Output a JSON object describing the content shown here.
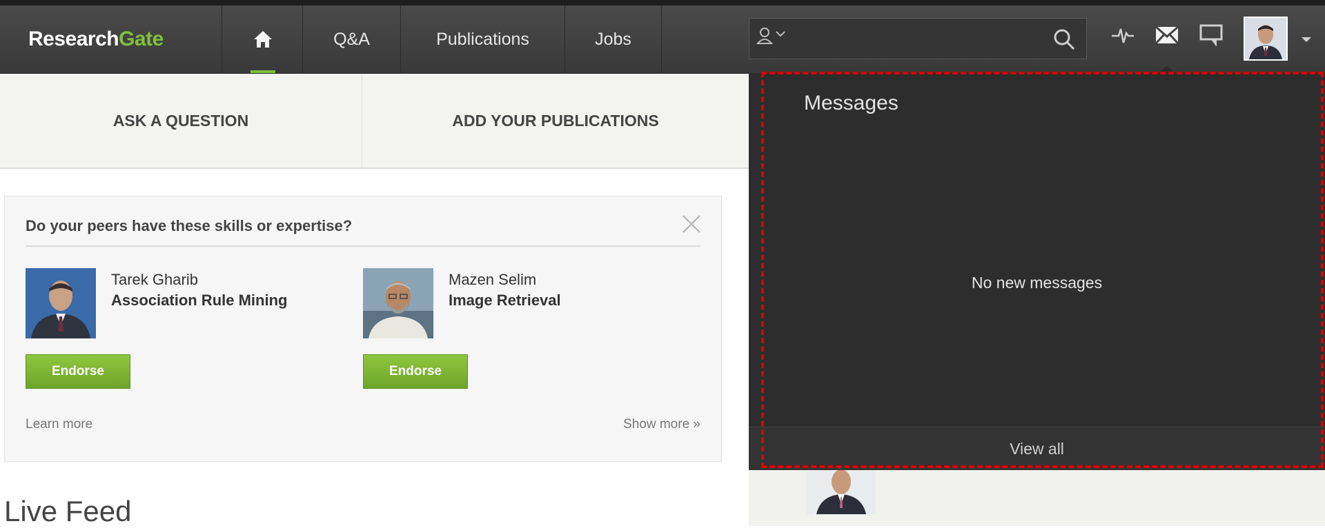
{
  "brand": {
    "word1": "Research",
    "word2": "Gate"
  },
  "nav": {
    "home_icon": "home-icon",
    "items": [
      {
        "label": "Q&A"
      },
      {
        "label": "Publications"
      },
      {
        "label": "Jobs"
      }
    ]
  },
  "search": {
    "value": "",
    "placeholder": ""
  },
  "top_icons": [
    "activity-icon",
    "messages-icon",
    "chat-icon"
  ],
  "actions": {
    "ask": "ASK A QUESTION",
    "add": "ADD YOUR PUBLICATIONS"
  },
  "skills_card": {
    "title": "Do your peers have these skills or expertise?",
    "peers": [
      {
        "name": "Tarek Gharib",
        "skill": "Association Rule Mining",
        "button": "Endorse"
      },
      {
        "name": "Mazen Selim",
        "skill": "Image Retrieval",
        "button": "Endorse"
      }
    ],
    "learn_more": "Learn more",
    "show_more": "Show more »"
  },
  "live_feed": {
    "title": "Live Feed"
  },
  "messages_panel": {
    "title": "Messages",
    "empty": "No new messages",
    "view_all": "View all"
  },
  "colors": {
    "brand_green": "#7fc13c",
    "nav_bg": "#424242",
    "panel_bg": "#2d2d2d",
    "highlight": "#e00000"
  }
}
